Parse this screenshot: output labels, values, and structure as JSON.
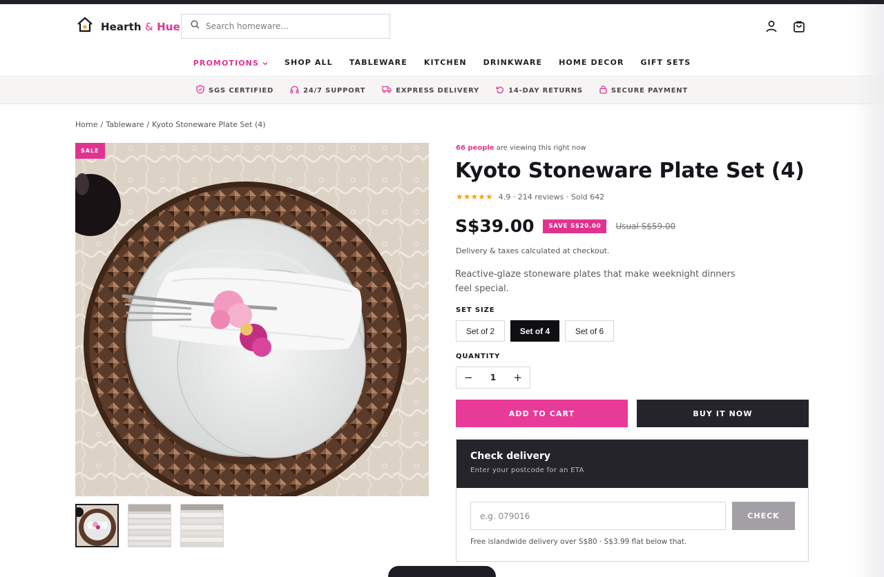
{
  "brand": {
    "name_part1": "Hearth",
    "amp": "&",
    "name_part2": "Hue",
    "accent_color": "#e0338f"
  },
  "search": {
    "placeholder": "Search homeware..."
  },
  "header_icons": [
    "user-icon",
    "bag-icon"
  ],
  "nav": [
    {
      "label": "PROMOTIONS",
      "highlight": true,
      "dropdown": true
    },
    {
      "label": "SHOP ALL"
    },
    {
      "label": "TABLEWARE"
    },
    {
      "label": "KITCHEN"
    },
    {
      "label": "DRINKWARE"
    },
    {
      "label": "HOME DECOR"
    },
    {
      "label": "GIFT SETS"
    }
  ],
  "trust": [
    {
      "icon": "shield-icon",
      "label": "SGS CERTIFIED"
    },
    {
      "icon": "headset-icon",
      "label": "24/7 SUPPORT"
    },
    {
      "icon": "truck-icon",
      "label": "EXPRESS DELIVERY"
    },
    {
      "icon": "return-icon",
      "label": "14-DAY RETURNS"
    },
    {
      "icon": "lock-icon",
      "label": "SECURE PAYMENT"
    }
  ],
  "breadcrumb": [
    "Home",
    "/",
    "Tableware",
    "/",
    "Kyoto Stoneware Plate Set (4)"
  ],
  "gallery": {
    "badge": "SALE",
    "thumb_count": 3
  },
  "product": {
    "viewing_count": "66 people",
    "viewing_text": "are viewing this right now",
    "title": "Kyoto Stoneware Plate Set (4)",
    "stars": "★★★★★",
    "rating_text": "4.9 · 214 reviews · Sold 642",
    "price": "S$39.00",
    "save_badge": "SAVE S$20.00",
    "usual_price": "Usual S$59.00",
    "delivery_note": "Delivery & taxes calculated at checkout.",
    "description": "Reactive-glaze stoneware plates that make weeknight dinners feel special."
  },
  "options": {
    "size_label": "SET SIZE",
    "sizes": [
      "Set of 2",
      "Set of 4",
      "Set of 6"
    ],
    "selected_size": "Set of 4",
    "quantity_label": "QUANTITY",
    "quantity": "1",
    "minus": "−",
    "plus": "+"
  },
  "actions": {
    "add_to_cart": "ADD TO CART",
    "buy_now": "BUY IT NOW"
  },
  "check_delivery": {
    "title": "Check delivery",
    "subtitle": "Enter your postcode for an ETA",
    "placeholder": "e.g. 079016",
    "button": "CHECK",
    "note": "Free islandwide delivery over S$80 · S$3.99 flat below that."
  }
}
